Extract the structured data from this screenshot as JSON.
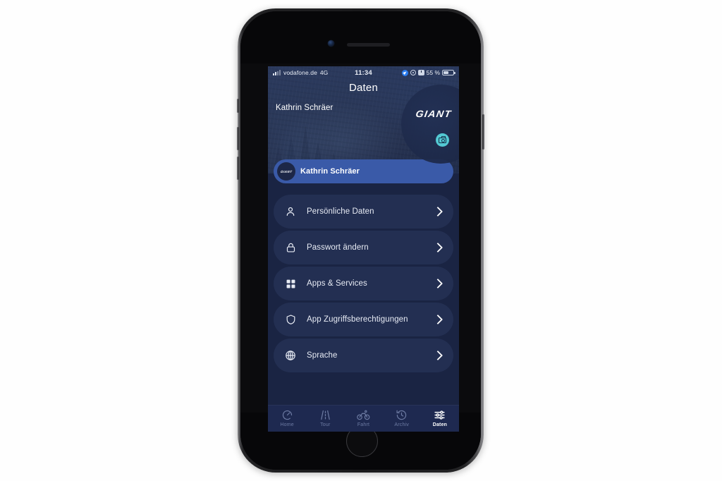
{
  "device": {
    "name": "iphone-8",
    "frame_color": "#1a1a1c"
  },
  "status_bar": {
    "carrier": "vodafone.de",
    "network": "4G",
    "time": "11:34",
    "battery_percent": "55 %",
    "icons": [
      "signal-bars-icon",
      "location-arrow-icon",
      "rotation-lock-icon",
      "alarm-clock-icon",
      "battery-icon"
    ]
  },
  "nav": {
    "title": "Daten"
  },
  "hero": {
    "user_name": "Kathrin Schräer",
    "brand_logo": "GIANT",
    "camera_button_label": "camera-icon",
    "accent_color": "#53c8d2"
  },
  "profile_row": {
    "label": "Kathrin Schräer",
    "avatar_logo": "GIANT",
    "highlight_color": "#3a5aa8"
  },
  "menu": {
    "items": [
      {
        "label": "Persönliche Daten",
        "icon": "person-icon"
      },
      {
        "label": "Passwort ändern",
        "icon": "lock-icon"
      },
      {
        "label": "Apps & Services",
        "icon": "grid-apps-icon"
      },
      {
        "label": "App Zugriffsberechtigungen",
        "icon": "shield-icon"
      },
      {
        "label": "Sprache",
        "icon": "globe-icon"
      }
    ]
  },
  "tabbar": {
    "items": [
      {
        "label": "Home",
        "icon": "speedometer-icon",
        "active": false
      },
      {
        "label": "Tour",
        "icon": "road-icon",
        "active": false
      },
      {
        "label": "Fahrt",
        "icon": "bicycle-icon",
        "active": false
      },
      {
        "label": "Archiv",
        "icon": "history-clock-icon",
        "active": false
      },
      {
        "label": "Daten",
        "icon": "sliders-icon",
        "active": true
      }
    ]
  },
  "colors": {
    "screen_background": "#1a2443",
    "row_background": "#232f52",
    "tabbar_background": "#1e2950",
    "accent": "#53c8d2",
    "highlight": "#3a5aa8"
  }
}
